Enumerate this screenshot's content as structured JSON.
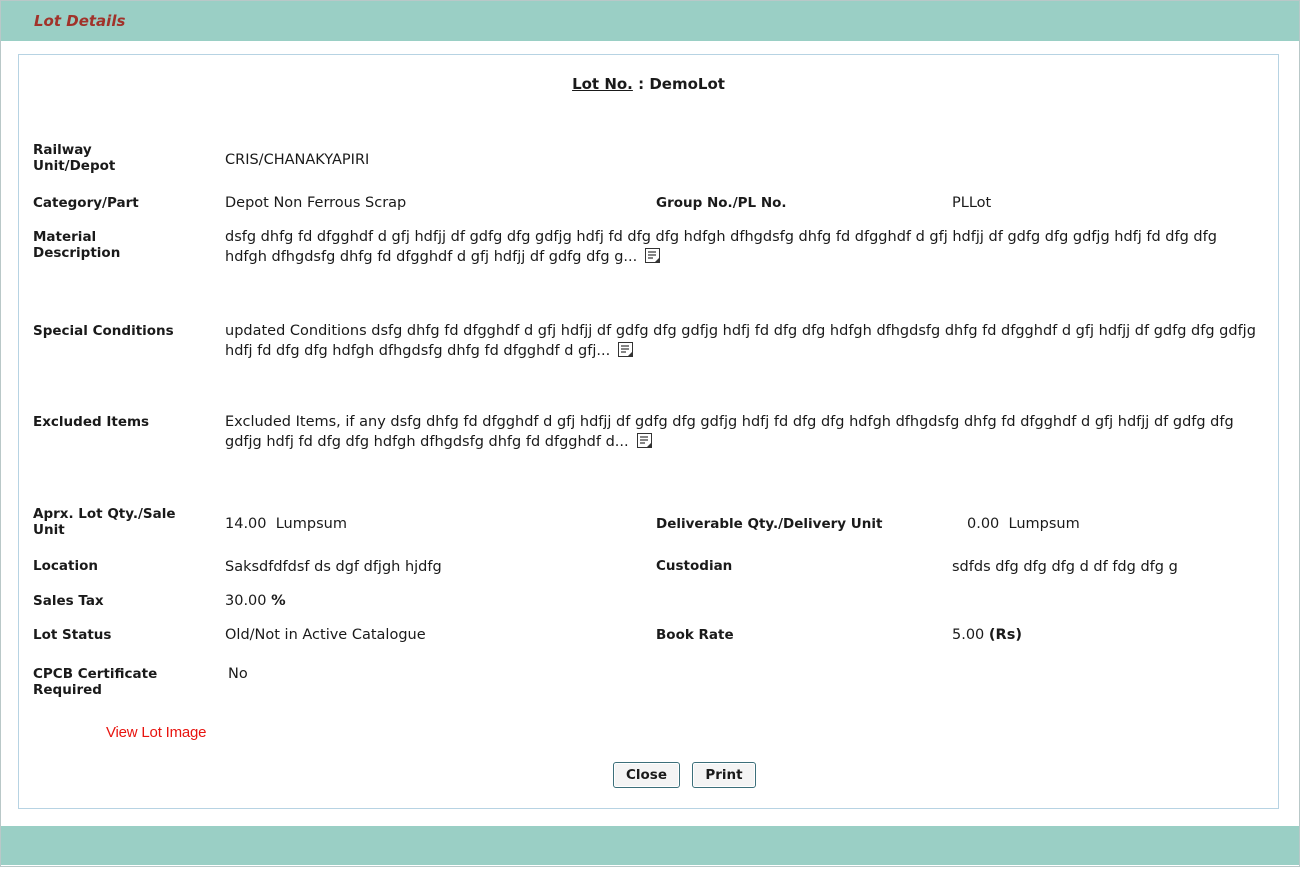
{
  "header": {
    "title": "Lot Details"
  },
  "lot": {
    "label": "Lot No.",
    "separator": " : ",
    "number": "DemoLot"
  },
  "fields": {
    "railway_unit": {
      "label": "Railway Unit/Depot",
      "value": "CRIS/CHANAKYAPIRI"
    },
    "category": {
      "label": "Category/Part",
      "value": "Depot Non Ferrous Scrap"
    },
    "group_no": {
      "label": "Group No./PL No.",
      "value": "PLLot"
    },
    "material_description": {
      "label": "Material Description",
      "value": "dsfg dhfg fd dfgghdf d gfj hdfjj df gdfg dfg gdfjg hdfj fd dfg dfg hdfgh dfhgdsfg dhfg fd dfgghdf d gfj hdfjj df gdfg dfg gdfjg hdfj fd dfg dfg hdfgh dfhgdsfg dhfg fd dfgghdf d gfj hdfjj df gdfg dfg g..."
    },
    "special_conditions": {
      "label": "Special Conditions",
      "value": "updated Conditions dsfg dhfg fd dfgghdf d gfj hdfjj df gdfg dfg gdfjg hdfj fd dfg dfg hdfgh dfhgdsfg dhfg fd dfgghdf d gfj hdfjj df gdfg dfg gdfjg hdfj fd dfg dfg hdfgh dfhgdsfg dhfg fd dfgghdf d gfj..."
    },
    "excluded_items": {
      "label": "Excluded Items",
      "value": "Excluded Items, if any dsfg dhfg fd dfgghdf d gfj hdfjj df gdfg dfg gdfjg hdfj fd dfg dfg hdfgh dfhgdsfg dhfg fd dfgghdf d gfj hdfjj df gdfg dfg gdfjg hdfj fd dfg dfg hdfgh dfhgdsfg dhfg fd dfgghdf d..."
    },
    "aprx_qty": {
      "label": "Aprx. Lot Qty./Sale Unit",
      "value": "14.00  Lumpsum"
    },
    "deliverable_qty": {
      "label": "Deliverable Qty./Delivery Unit",
      "value": "0.00  Lumpsum"
    },
    "location": {
      "label": "Location",
      "value": "Saksdfdfdsf ds dgf dfjgh hjdfg"
    },
    "custodian": {
      "label": "Custodian",
      "value": "sdfds dfg dfg dfg d df fdg dfg g"
    },
    "sales_tax": {
      "label": "Sales Tax",
      "value": "30.00",
      "unit": "%"
    },
    "lot_status": {
      "label": "Lot Status",
      "value": "Old/Not in Active Catalogue"
    },
    "book_rate": {
      "label": "Book Rate",
      "value": "5.00",
      "unit": "(Rs)"
    },
    "cpcb": {
      "label": "CPCB Certificate Required",
      "value": "No"
    }
  },
  "links": {
    "view_lot_image": "View Lot Image"
  },
  "buttons": {
    "close": "Close",
    "print": "Print"
  },
  "icons": {
    "note": "note-icon"
  },
  "colors": {
    "header_bg": "#9acfc5",
    "title_text": "#a1322a",
    "link_red": "#e8140f",
    "panel_border": "#b7d3e3"
  }
}
